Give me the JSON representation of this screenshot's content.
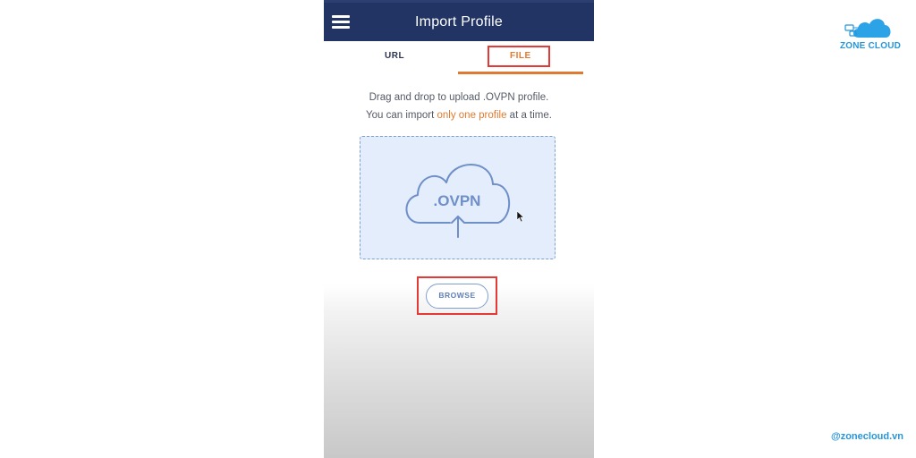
{
  "app": {
    "title": "Import Profile",
    "menu_icon": "hamburger-menu-icon"
  },
  "tabs": [
    {
      "label": "URL",
      "active": false
    },
    {
      "label": "FILE",
      "active": true
    }
  ],
  "instructions": {
    "line1": "Drag and drop to upload .OVPN profile.",
    "line2_prefix": "You can import ",
    "line2_highlight": "only one profile",
    "line2_suffix": " at a time."
  },
  "dropzone": {
    "icon": "cloud-upload-icon",
    "icon_label": ".OVPN"
  },
  "browse_button": {
    "label": "BROWSE"
  },
  "branding": {
    "logo_text": "ZONE CLOUD",
    "handle": "@zonecloud.vn"
  },
  "colors": {
    "appbar": "#223463",
    "accent": "#e07a30",
    "dropzone_bg": "#e3edfb",
    "dropzone_border": "#7f9fd0",
    "highlight_box": "#e53935",
    "brand": "#2596d9"
  }
}
